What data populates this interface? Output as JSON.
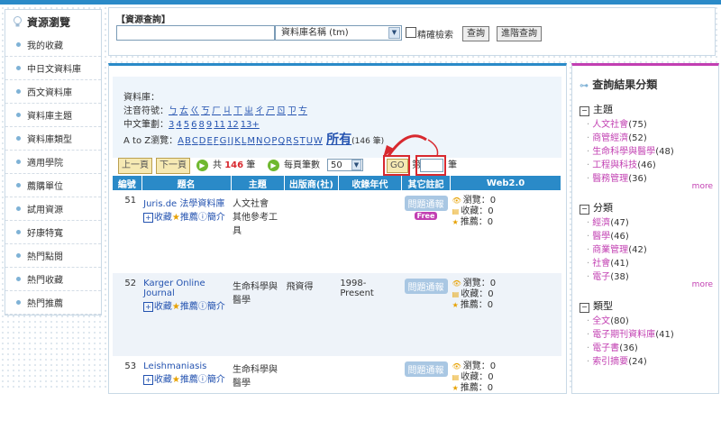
{
  "sidebar": {
    "title": "資源瀏覽",
    "items": [
      "我的收藏",
      "中日文資料庫",
      "西文資料庫",
      "資料庫主題",
      "資料庫類型",
      "適用學院",
      "薦購單位",
      "試用資源",
      "好康特寬",
      "熱門點閱",
      "熱門收藏",
      "熱門推薦"
    ]
  },
  "search": {
    "label": "【資源查詢】",
    "select_value": "資料庫名稱 (tm)",
    "exact_label": "精確檢索",
    "query_btn": "查詢",
    "advanced_btn": "進階查詢"
  },
  "filters": {
    "db_label": "資料庫：",
    "zhuyin_label": "注音符號：",
    "zhuyin": [
      "ㄅ",
      "ㄊ",
      "ㄍ",
      "ㄎ",
      "ㄏ",
      "ㄐ",
      "ㄒ",
      "ㄓ",
      "ㄔ",
      "ㄕ",
      "ㄖ",
      "ㄗ",
      "ㄘ"
    ],
    "strokes_label": "中文筆劃：",
    "strokes": [
      "3",
      "4",
      "5",
      "6",
      "8",
      "9",
      "11",
      "12",
      "13+"
    ],
    "az_label": "A to Z瀏覽：",
    "letters": [
      "A",
      "B",
      "C",
      "D",
      "E",
      "F",
      "G",
      "I",
      "J",
      "K",
      "L",
      "M",
      "N",
      "O",
      "P",
      "Q",
      "R",
      "S",
      "T",
      "U",
      "W"
    ],
    "all_label": "所有",
    "all_count": "(146 筆)"
  },
  "pager": {
    "prev": "上一頁",
    "next": "下一頁",
    "total_prefix": "共",
    "total": "146",
    "total_suffix": "筆",
    "per_page_label": "每頁筆數",
    "per_page": "50",
    "go": "GO",
    "page_prefix": "第",
    "page_suffix": "筆"
  },
  "table": {
    "headers": [
      "編號",
      "題名",
      "主題",
      "出版商(社)",
      "收錄年代",
      "其它註記",
      "Web2.0"
    ],
    "actions": {
      "collect": "收藏",
      "recommend": "推薦",
      "intro": "簡介"
    },
    "report_label": "問題通報",
    "free_label": "Free",
    "web2": {
      "views": "瀏覽：0",
      "collects": "收藏：0",
      "recommends": "推薦：0"
    },
    "rows": [
      {
        "no": "51",
        "title": "Juris.de 法學資料庫",
        "subject": "人文社會\n其他參考工具",
        "publisher": "",
        "years": "",
        "free": true
      },
      {
        "no": "52",
        "title": "Karger Online Journal",
        "subject": "生命科學與醫學",
        "publisher": "飛資得",
        "years": "1998-Present",
        "free": false
      },
      {
        "no": "53",
        "title": "Leishmaniasis",
        "subject": "生命科學與醫學",
        "publisher": "",
        "years": "",
        "free": false
      }
    ]
  },
  "right": {
    "title": "查詢結果分類",
    "sections": [
      {
        "name": "主題",
        "items": [
          [
            "人文社會",
            "(75)"
          ],
          [
            "商管經濟",
            "(52)"
          ],
          [
            "生命科學與醫學",
            "(48)"
          ],
          [
            "工程與科技",
            "(46)"
          ],
          [
            "醫務管理",
            "(36)"
          ]
        ]
      },
      {
        "name": "分類",
        "items": [
          [
            "經濟",
            "(47)"
          ],
          [
            "醫學",
            "(46)"
          ],
          [
            "商業管理",
            "(42)"
          ],
          [
            "社會",
            "(41)"
          ],
          [
            "電子",
            "(38)"
          ]
        ]
      },
      {
        "name": "類型",
        "items": [
          [
            "全文",
            "(80)"
          ],
          [
            "電子期刊資料庫",
            "(41)"
          ],
          [
            "電子書",
            "(36)"
          ],
          [
            "索引摘要",
            "(24)"
          ]
        ]
      }
    ],
    "more": "more"
  }
}
